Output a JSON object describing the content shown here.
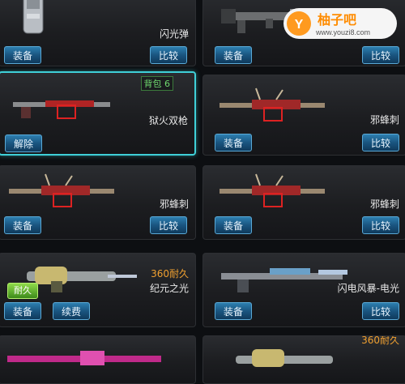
{
  "logo": {
    "brand_cn": "柚子吧",
    "url": "www.youzi8.com",
    "mark": "Y"
  },
  "cards": [
    {
      "name": "闪光弹",
      "buttons": [
        "装备",
        "比较"
      ]
    },
    {
      "name": "",
      "buttons": [
        "装备",
        "比较"
      ]
    },
    {
      "name": "狱火双枪",
      "bag": "背包 6",
      "buttons": [
        "解除"
      ],
      "selected": true
    },
    {
      "name": "邪蜂刺",
      "buttons": [
        "装备",
        "比较"
      ]
    },
    {
      "name": "邪蜂刺",
      "buttons": [
        "装备",
        "比较"
      ]
    },
    {
      "name": "邪蜂刺",
      "buttons": [
        "装备",
        "比较"
      ]
    },
    {
      "name": "纪元之光",
      "durability": "360耐久",
      "badge": "耐久",
      "buttons": [
        "装备",
        "续费"
      ]
    },
    {
      "name": "闪电风暴-电光",
      "buttons": [
        "装备",
        "比较"
      ]
    },
    {
      "name": "",
      "buttons": []
    },
    {
      "name": "",
      "durability": "360耐久",
      "buttons": []
    }
  ],
  "colors": {
    "select_border": "#3fd0d8",
    "durability_text": "#f0a030",
    "button": "#1a5580"
  }
}
